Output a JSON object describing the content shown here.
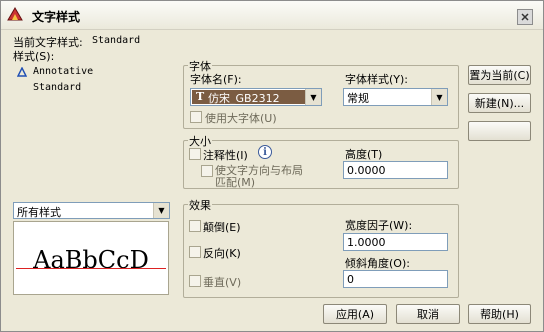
{
  "window": {
    "title": "文字样式"
  },
  "current_style": {
    "label": "当前文字样式:",
    "value": "Standard"
  },
  "styles": {
    "label": "样式(S):",
    "items": [
      "Annotative",
      "Standard"
    ]
  },
  "filter": {
    "value": "所有样式"
  },
  "preview": {
    "text": "AaBbCcD"
  },
  "font_group": {
    "title": "字体",
    "font_name_label": "字体名(F):",
    "font_name_value": "仿宋_GB2312",
    "font_type_glyph": "T",
    "font_style_label": "字体样式(Y):",
    "font_style_value": "常规",
    "big_font_label": "使用大字体(U)"
  },
  "size_group": {
    "title": "大小",
    "annotative_label": "注释性(I)",
    "info_glyph": "i",
    "match_orientation_line1": "使文字方向与布局",
    "match_orientation_line2": "匹配(M)",
    "height_label": "高度(T)",
    "height_value": "0.0000"
  },
  "effects_group": {
    "title": "效果",
    "upside_down_label": "颠倒(E)",
    "backwards_label": "反向(K)",
    "vertical_label": "垂直(V)",
    "width_factor_label": "宽度因子(W):",
    "width_factor_value": "1.0000",
    "oblique_label": "倾斜角度(O):",
    "oblique_value": "0"
  },
  "side_buttons": {
    "set_current": "置为当前(C)",
    "new": "新建(N)...",
    "delete": ""
  },
  "bottom_buttons": {
    "apply": "应用(A)",
    "cancel": "取消",
    "help": "帮助(H)"
  },
  "colors": {
    "dialog_bg": "#ece9d8",
    "selected_font_bg": "#7b5c42",
    "preview_baseline": "#dd2222"
  }
}
